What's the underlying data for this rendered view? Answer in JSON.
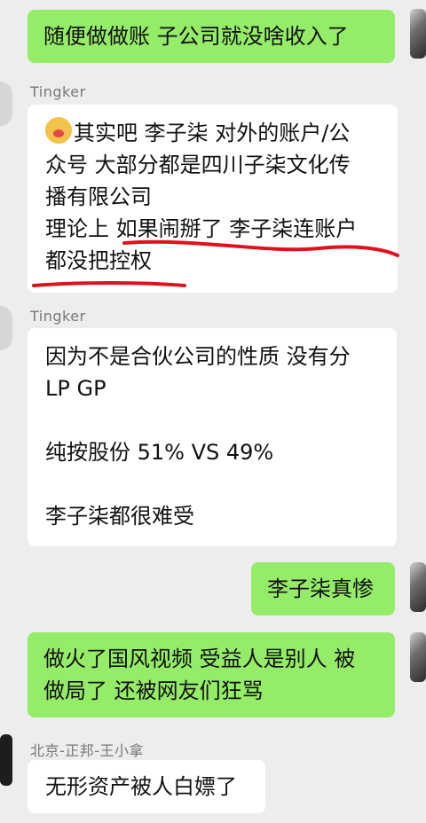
{
  "messages": [
    {
      "id": "m1",
      "side": "right",
      "lines": [
        "随便做做账 子公司就没啥收入了"
      ]
    },
    {
      "id": "m2",
      "side": "left",
      "sender": "Tingker",
      "emoji": "face-with-hand-over-mouth",
      "lines": [
        "其实吧 李子柒 对外的账户/公",
        "众号 大部分都是四川子柒文化传",
        "播有限公司",
        "理论上 如果闹掰了  李子柒连账户",
        "都没把控权"
      ],
      "annotation": {
        "type": "red-underline",
        "color": "#e0101c"
      }
    },
    {
      "id": "m3",
      "side": "left",
      "sender": "Tingker",
      "lines": [
        "因为不是合伙公司的性质 没有分",
        "LP GP",
        "",
        "纯按股份 51% VS 49%",
        "",
        "李子柒都很难受"
      ]
    },
    {
      "id": "m4",
      "side": "right",
      "lines": [
        "李子柒真惨"
      ]
    },
    {
      "id": "m5",
      "side": "right",
      "lines": [
        "做火了国风视频 受益人是别人 被",
        "做局了 还被网友们狂骂"
      ]
    },
    {
      "id": "m6",
      "side": "left",
      "sender": "北京-正邦-王小拿",
      "lines": [
        "无形资产被人白嫖了"
      ]
    }
  ],
  "colors": {
    "own_bubble": "#95ec69",
    "other_bubble": "#ffffff",
    "background": "#ededed",
    "sender_name": "#777777"
  }
}
